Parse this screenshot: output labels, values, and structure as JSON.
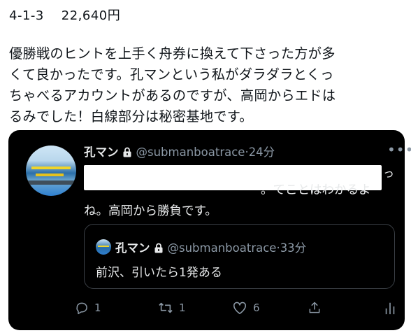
{
  "result": {
    "combo": "4-1-3",
    "payout": "22,640円"
  },
  "post_lines": [
    "優勝戦のヒントを上手く舟券に換えて下さった方が多",
    "くて良かったです。孔マンという私がダラダラとくっ",
    "ちゃべるアカウントがあるのですが、高岡からエドは",
    "るみでした！白線部分は秘密基地です。"
  ],
  "embedded_post": {
    "name": "孔マン",
    "handle": "@submanboatrace",
    "separator": "·",
    "time": "24分",
    "more": "•••",
    "text_tail": "っ",
    "text_line2": "。てことはわかるよ",
    "text_line3": "ね。高岡から勝負です。",
    "quoted": {
      "name": "孔マン",
      "handle": "@submanboatrace",
      "separator": "·",
      "time": "33分",
      "text": "前沢、引いたら1発ある"
    },
    "actions": {
      "reply_count": "1",
      "retweet_count": "1",
      "like_count": "6"
    }
  },
  "icons": [
    "lock-icon",
    "reply-icon",
    "retweet-icon",
    "like-icon",
    "share-icon",
    "analytics-icon",
    "more-icon"
  ],
  "colors": {
    "card_bg": "#000000",
    "text_primary": "#e7e9ea",
    "text_secondary": "#8b98a5",
    "border": "#3a3f45"
  }
}
